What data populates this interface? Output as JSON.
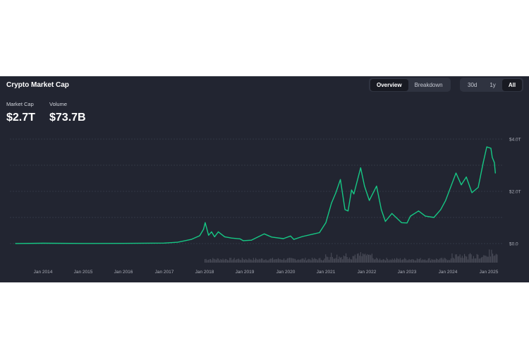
{
  "header": {
    "title": "Crypto Market Cap",
    "tabs": [
      {
        "label": "Overview",
        "active": true
      },
      {
        "label": "Breakdown",
        "active": false
      }
    ],
    "ranges": [
      {
        "label": "30d",
        "active": false
      },
      {
        "label": "1y",
        "active": false
      },
      {
        "label": "All",
        "active": true
      }
    ]
  },
  "stats": {
    "market_cap_label": "Market Cap",
    "market_cap_value": "$2.7T",
    "volume_label": "Volume",
    "volume_value": "$73.7B"
  },
  "colors": {
    "background": "#222531",
    "line": "#16c784",
    "grid": "#3a3e4c",
    "volume": "#4a4d59"
  },
  "chart_data": {
    "type": "line",
    "title": "",
    "xlabel": "",
    "ylabel": "",
    "x_ticks": [
      "Jan 2014",
      "Jan 2015",
      "Jan 2016",
      "Jan 2017",
      "Jan 2018",
      "Jan 2019",
      "Jan 2020",
      "Jan 2021",
      "Jan 2022",
      "Jan 2023",
      "Jan 2024",
      "Jan 2025"
    ],
    "y_ticks": [
      "$0.0",
      "$2.0T",
      "$4.0T"
    ],
    "ylim": [
      0,
      4.0
    ],
    "y_unit": "trillion USD",
    "grid": true,
    "series": [
      {
        "values": [
          [
            "2013-04-28",
            0.0016
          ],
          [
            "2014-01-01",
            0.013
          ],
          [
            "2015-01-01",
            0.005
          ],
          [
            "2016-01-01",
            0.007
          ],
          [
            "2017-01-01",
            0.018
          ],
          [
            "2017-05-01",
            0.05
          ],
          [
            "2017-09-01",
            0.16
          ],
          [
            "2017-11-15",
            0.3
          ],
          [
            "2017-12-20",
            0.55
          ],
          [
            "2018-01-07",
            0.8
          ],
          [
            "2018-02-06",
            0.32
          ],
          [
            "2018-03-05",
            0.45
          ],
          [
            "2018-04-01",
            0.26
          ],
          [
            "2018-05-05",
            0.45
          ],
          [
            "2018-07-01",
            0.26
          ],
          [
            "2018-09-01",
            0.21
          ],
          [
            "2018-11-15",
            0.18
          ],
          [
            "2018-12-15",
            0.11
          ],
          [
            "2019-03-01",
            0.13
          ],
          [
            "2019-06-26",
            0.37
          ],
          [
            "2019-09-01",
            0.25
          ],
          [
            "2019-12-15",
            0.19
          ],
          [
            "2020-02-14",
            0.29
          ],
          [
            "2020-03-15",
            0.16
          ],
          [
            "2020-06-01",
            0.27
          ],
          [
            "2020-09-01",
            0.36
          ],
          [
            "2020-11-01",
            0.42
          ],
          [
            "2021-01-01",
            0.8
          ],
          [
            "2021-02-21",
            1.55
          ],
          [
            "2021-04-01",
            1.95
          ],
          [
            "2021-05-12",
            2.45
          ],
          [
            "2021-06-22",
            1.3
          ],
          [
            "2021-07-20",
            1.25
          ],
          [
            "2021-08-20",
            2.05
          ],
          [
            "2021-09-10",
            1.9
          ],
          [
            "2021-11-10",
            2.9
          ],
          [
            "2021-12-15",
            2.2
          ],
          [
            "2022-01-24",
            1.65
          ],
          [
            "2022-03-30",
            2.2
          ],
          [
            "2022-05-12",
            1.3
          ],
          [
            "2022-06-18",
            0.85
          ],
          [
            "2022-08-15",
            1.15
          ],
          [
            "2022-11-10",
            0.8
          ],
          [
            "2022-12-30",
            0.79
          ],
          [
            "2023-02-01",
            1.05
          ],
          [
            "2023-04-15",
            1.25
          ],
          [
            "2023-06-15",
            1.05
          ],
          [
            "2023-09-01",
            1.0
          ],
          [
            "2023-11-01",
            1.3
          ],
          [
            "2023-12-15",
            1.65
          ],
          [
            "2024-03-14",
            2.7
          ],
          [
            "2024-05-01",
            2.25
          ],
          [
            "2024-06-15",
            2.55
          ],
          [
            "2024-08-05",
            1.95
          ],
          [
            "2024-10-01",
            2.15
          ],
          [
            "2024-11-15",
            3.1
          ],
          [
            "2024-12-17",
            3.7
          ],
          [
            "2025-01-20",
            3.65
          ],
          [
            "2025-02-01",
            3.3
          ],
          [
            "2025-02-20",
            3.1
          ],
          [
            "2025-03-01",
            2.7
          ]
        ]
      }
    ]
  }
}
